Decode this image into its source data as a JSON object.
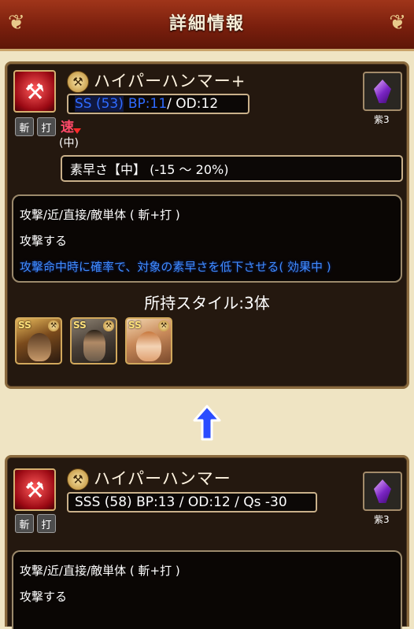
{
  "header": {
    "title": "詳細情報"
  },
  "current": {
    "skill_name": "ハイパーハンマー+",
    "rank": "SS (53)",
    "bp": "BP:11",
    "od": " / OD:12",
    "gem_label": "紫3",
    "attrs": [
      "斬",
      "打"
    ],
    "speed_icon": "速",
    "speed_level": "(中)",
    "effect": "素早さ【中】 (-15 〜 20%)",
    "desc": [
      "攻撃/近/直接/敵単体 ( 斬+打 )",
      "攻撃する",
      "攻撃命中時に確率で、対象の素早さを低下させる( 効果中 )"
    ],
    "styles_title": "所持スタイル:3体",
    "style_badge": "SS",
    "styles": [
      "style-1",
      "style-2",
      "style-3"
    ]
  },
  "previous": {
    "skill_name": "ハイパーハンマー",
    "stats": "SSS (58) BP:13 / OD:12 / Qs -30",
    "gem_label": "紫3",
    "attrs": [
      "斬",
      "打"
    ],
    "desc": [
      "攻撃/近/直接/敵単体 ( 斬+打 )",
      "攻撃する"
    ]
  },
  "icons": {
    "skill": "axe-icon",
    "weapon": "axe-weapon-icon",
    "gem": "purple-gem-icon",
    "upgrade": "arrow-up-icon"
  },
  "colors": {
    "header": "#7a1f0d",
    "highlight": "#3f8cff",
    "rank_blue": "#2f6bff"
  }
}
